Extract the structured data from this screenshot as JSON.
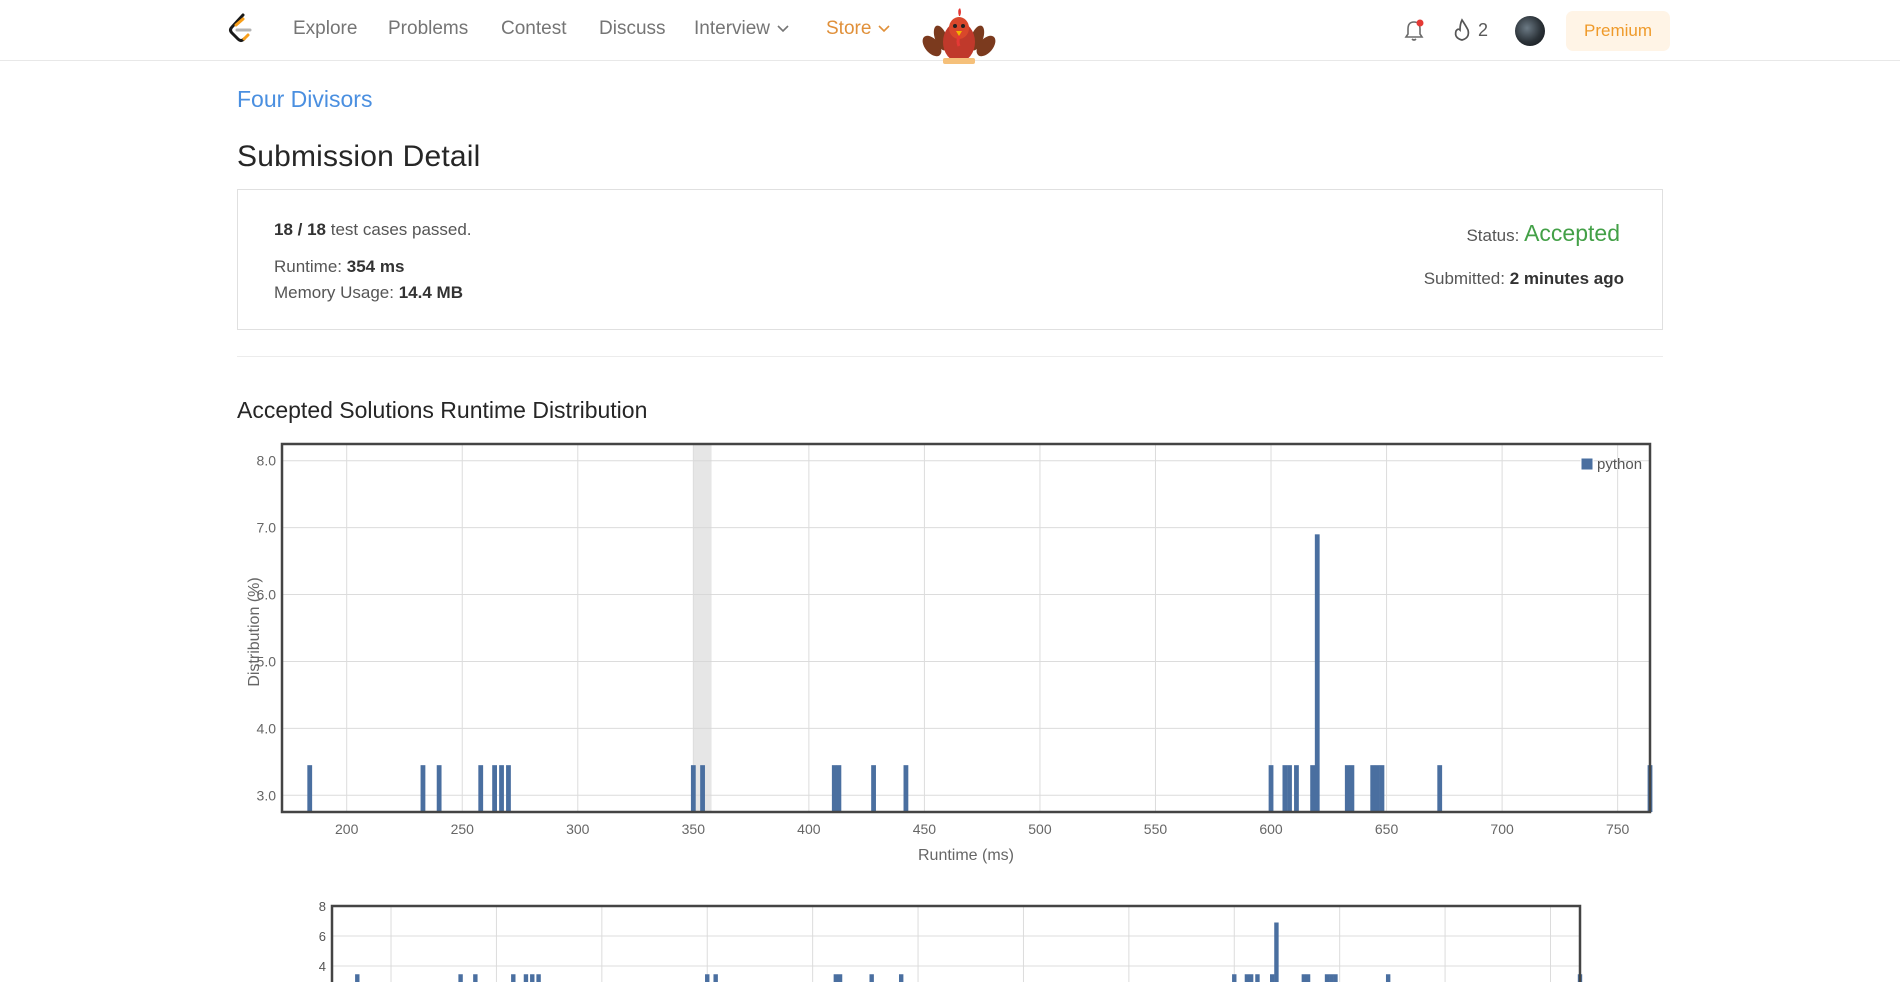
{
  "navbar": {
    "items": [
      {
        "label": "Explore"
      },
      {
        "label": "Problems"
      },
      {
        "label": "Contest"
      },
      {
        "label": "Discuss"
      },
      {
        "label": "Interview"
      },
      {
        "label": "Store"
      }
    ],
    "streak_count": "2",
    "premium_label": "Premium",
    "colors": {
      "store": "#e0903a",
      "premium_text": "#ef9a2a",
      "premium_bg": "#fff4e6",
      "notification_dot": "#e53935"
    }
  },
  "problem": {
    "title": "Four Divisors"
  },
  "page": {
    "title": "Submission Detail"
  },
  "submission": {
    "passed": "18 / 18",
    "passed_suffix": "test cases passed.",
    "runtime_label": "Runtime:",
    "runtime_value": "354 ms",
    "memory_label": "Memory Usage:",
    "memory_value": "14.4 MB",
    "status_label": "Status:",
    "status_value": "Accepted",
    "submitted_label": "Submitted:",
    "submitted_value": "2 minutes ago",
    "colors": {
      "accepted": "#43a047"
    }
  },
  "distribution": {
    "title": "Accepted Solutions Runtime Distribution"
  },
  "chart_data": [
    {
      "type": "bar",
      "xlabel": "Runtime (ms)",
      "ylabel": "Distribution (%)",
      "xlim": [
        172,
        764
      ],
      "ylim": [
        2.75,
        8.25
      ],
      "xticks": [
        "200",
        "250",
        "300",
        "350",
        "400",
        "450",
        "500",
        "550",
        "600",
        "650",
        "700",
        "750"
      ],
      "yticks": [
        "3.0",
        "4.0",
        "5.0",
        "6.0",
        "7.0",
        "8.0"
      ],
      "grid": true,
      "legend": "top-right",
      "highlight_x": 354,
      "series": [
        {
          "name": "python",
          "color": "#4a6fa0",
          "x": [
            184,
            233,
            240,
            258,
            264,
            267,
            270,
            350,
            354,
            411,
            413,
            428,
            442,
            600,
            606,
            608,
            611,
            618,
            620,
            633,
            635,
            644,
            646,
            648,
            673,
            764
          ],
          "values": [
            3.45,
            3.45,
            3.45,
            3.45,
            3.45,
            3.45,
            3.45,
            3.45,
            3.45,
            3.45,
            3.45,
            3.45,
            3.45,
            3.45,
            3.45,
            3.45,
            3.45,
            3.45,
            6.9,
            3.45,
            3.45,
            3.45,
            3.45,
            3.45,
            3.45,
            3.45
          ]
        }
      ]
    },
    {
      "type": "bar",
      "xlim": [
        172,
        764
      ],
      "ylim": [
        0,
        8
      ],
      "yticks": [
        "8",
        "6",
        "4"
      ],
      "grid": true,
      "series": [
        {
          "color": "#4a6fa0",
          "x": [
            184,
            233,
            240,
            258,
            264,
            267,
            270,
            350,
            354,
            411,
            413,
            428,
            442,
            600,
            606,
            608,
            611,
            618,
            620,
            633,
            635,
            644,
            646,
            648,
            673,
            764
          ],
          "values": [
            3.45,
            3.45,
            3.45,
            3.45,
            3.45,
            3.45,
            3.45,
            3.45,
            3.45,
            3.45,
            3.45,
            3.45,
            3.45,
            3.45,
            3.45,
            3.45,
            3.45,
            3.45,
            6.9,
            3.45,
            3.45,
            3.45,
            3.45,
            3.45,
            3.45,
            3.45
          ]
        }
      ]
    }
  ]
}
